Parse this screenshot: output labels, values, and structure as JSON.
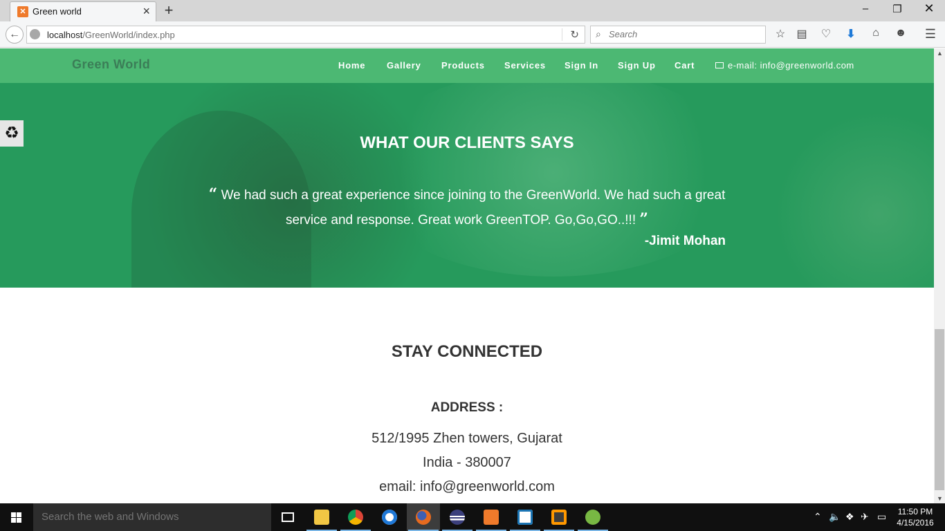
{
  "browser": {
    "tab_title": "Green world",
    "tab_favicon": "xampp-icon",
    "url_host": "localhost",
    "url_path": "/GreenWorld/index.php",
    "search_placeholder": "Search",
    "new_tab_symbol": "+"
  },
  "site": {
    "brand": "Green World",
    "nav": {
      "home": "Home",
      "gallery": "Gallery",
      "products": "Products",
      "services": "Services",
      "sign_in": "Sign In",
      "sign_up": "Sign Up",
      "cart": "Cart",
      "email": "e-mail: info@greenworld.com"
    },
    "testimonial": {
      "heading": "WHAT OUR CLIENTS SAYS",
      "open_quote": "“",
      "quote": "We had such a great experience since joining to the GreenWorld. We had such a great service and response. Great work GreenTOP. Go,Go,GO..!!!",
      "close_quote": "”",
      "author": "-Jimit Mohan"
    },
    "contact": {
      "heading": "STAY CONNECTED",
      "address_heading": "ADDRESS :",
      "address_line1": "512/1995 Zhen towers, Gujarat",
      "address_line2": "India - 380007",
      "email_line": "email: info@greenworld.com"
    },
    "colors": {
      "nav_green": "#4cb873",
      "banner_green": "#269a5c",
      "brand_text": "#3b7d57"
    }
  },
  "taskbar": {
    "search_placeholder": "Search the web and Windows",
    "time": "11:50 PM",
    "date": "4/15/2016",
    "apps": [
      "task-view",
      "file-explorer",
      "chrome",
      "edge",
      "firefox",
      "eclipse",
      "xampp",
      "netbeans",
      "sublime-text",
      "utorrent"
    ]
  }
}
